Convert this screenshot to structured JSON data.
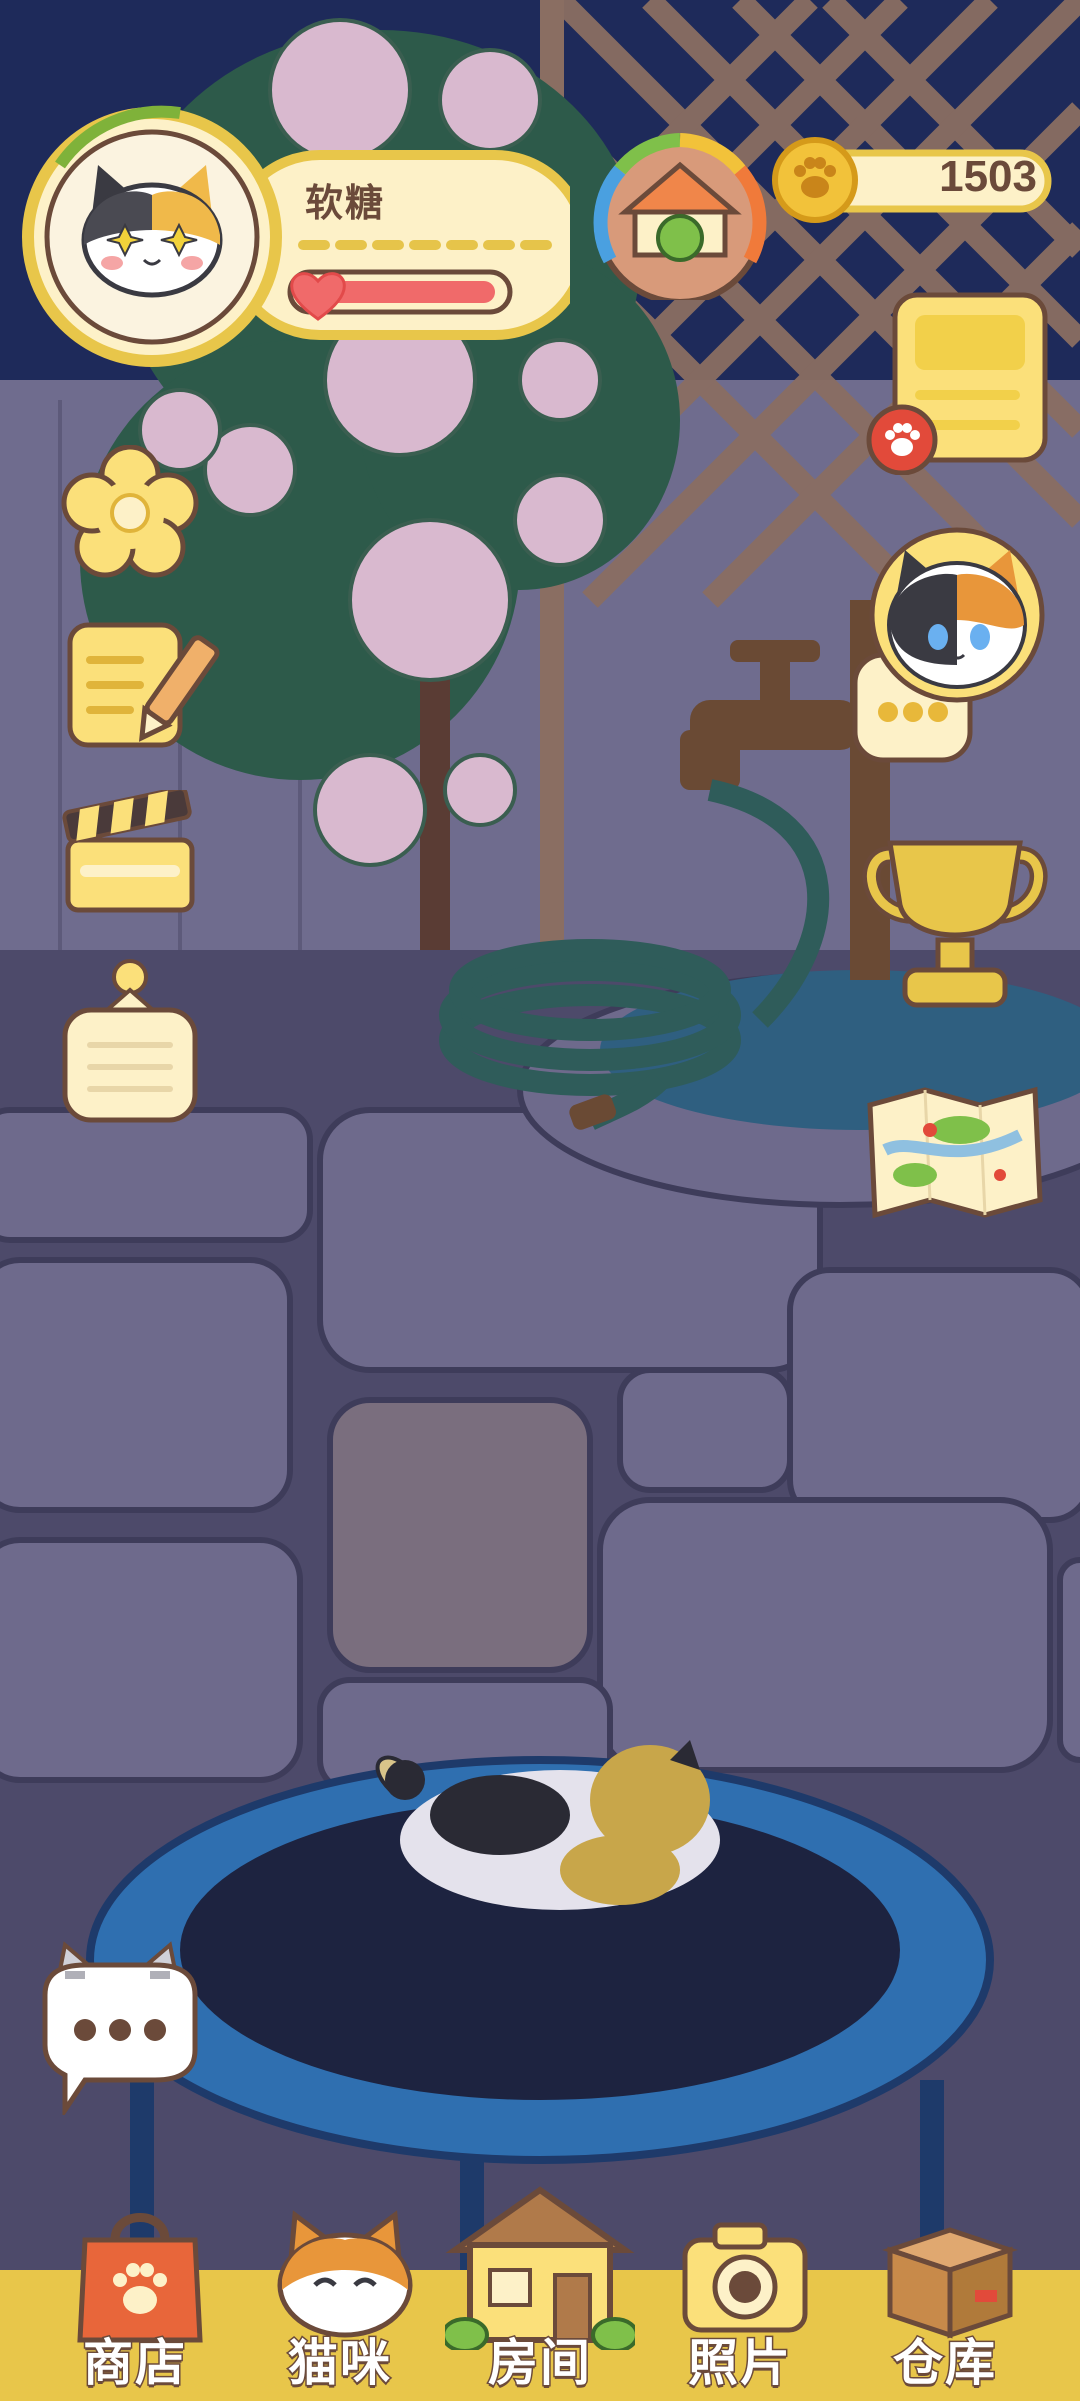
{
  "profile": {
    "name": "软糖"
  },
  "currency": {
    "coins": "1503"
  },
  "left_menu": [
    {
      "icon": "flower-icon"
    },
    {
      "icon": "notepad-pencil-icon"
    },
    {
      "icon": "clapperboard-icon"
    },
    {
      "icon": "hanging-sign-icon"
    }
  ],
  "right_menu": [
    {
      "icon": "task-list-icon"
    },
    {
      "icon": "cat-message-icon"
    },
    {
      "icon": "trophy-icon"
    },
    {
      "icon": "map-icon"
    }
  ],
  "nav": [
    {
      "label": "商店",
      "icon": "shopping-bag-icon"
    },
    {
      "label": "猫咪",
      "icon": "cat-face-icon"
    },
    {
      "label": "房间",
      "icon": "house-icon"
    },
    {
      "label": "照片",
      "icon": "camera-icon"
    },
    {
      "label": "仓库",
      "icon": "box-icon"
    }
  ],
  "colors": {
    "night_sky": "#1e2a5a",
    "ground": "#5e5a7e",
    "nav_bar": "#e8c64a",
    "accent_brown": "#6b4a3a",
    "health": "#f06a6a"
  }
}
